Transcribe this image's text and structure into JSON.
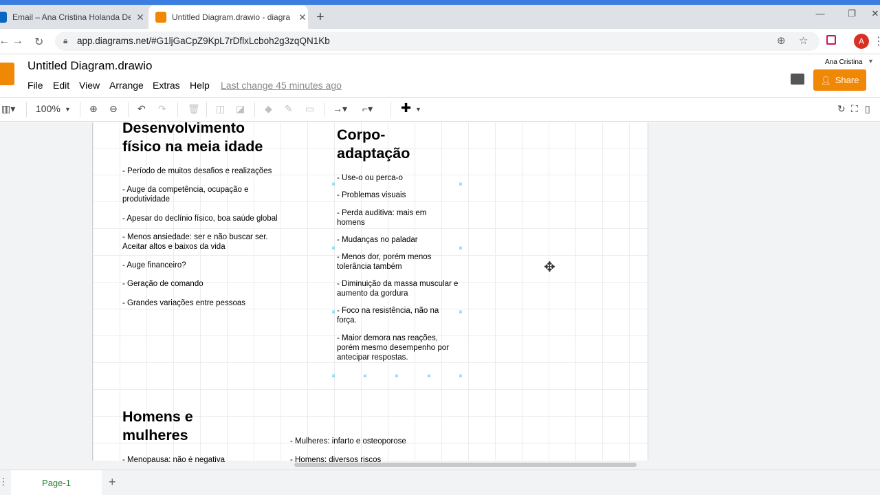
{
  "browser": {
    "tabs": [
      {
        "title": "Email – Ana Cristina Holanda De",
        "favicon_color": "#0a66c2"
      },
      {
        "title": "Untitled Diagram.drawio - diagra",
        "favicon_color": "#f08705"
      }
    ],
    "new_tab": "+",
    "url": "app.diagrams.net/#G1ljGaCpZ9KpL7rDflxLcboh2g3zqQN1Kb",
    "profile_initial": "A"
  },
  "app": {
    "title": "Untitled Diagram.drawio",
    "menus": [
      "File",
      "Edit",
      "View",
      "Arrange",
      "Extras",
      "Help"
    ],
    "last_change": "Last change 45 minutes ago",
    "user": "Ana Cristina",
    "share": "Share",
    "accent": "#f08705"
  },
  "toolbar": {
    "zoom": "100%"
  },
  "diagram": {
    "block1": {
      "title": "Desenvolvimento físico na meia idade",
      "items": [
        "- Período de muitos desafios e realizações",
        "- Auge da competência, ocupação e produtividade",
        "- Apesar do declínio físico, boa saúde global",
        "- Menos ansiedade: ser e não buscar ser. Aceitar altos e baixos da vida",
        "- Auge financeiro?",
        "- Geração de comando",
        "- Grandes variações entre pessoas"
      ]
    },
    "block2": {
      "title": "Corpo-adaptação",
      "items": [
        "- Use-o ou perca-o",
        "- Problemas visuais",
        "- Perda auditiva: mais em homens",
        "- Mudanças no paladar",
        "- Menos dor, porém menos tolerância também",
        "- Diminuição da massa muscular e aumento da gordura",
        "- Foco na resistência, não na força.",
        "- Maior demora nas reações, porém mesmo desempenho por antecipar respostas."
      ]
    },
    "block3": {
      "title": "Homens e mulheres",
      "items": [
        "- Menopausa: não é negativa"
      ]
    },
    "block4": {
      "items": [
        "- Mulheres: infarto e osteoporose",
        "- Homens: diversos riscos"
      ]
    }
  },
  "pages": {
    "tabs": [
      "Page-1"
    ],
    "add": "+"
  }
}
